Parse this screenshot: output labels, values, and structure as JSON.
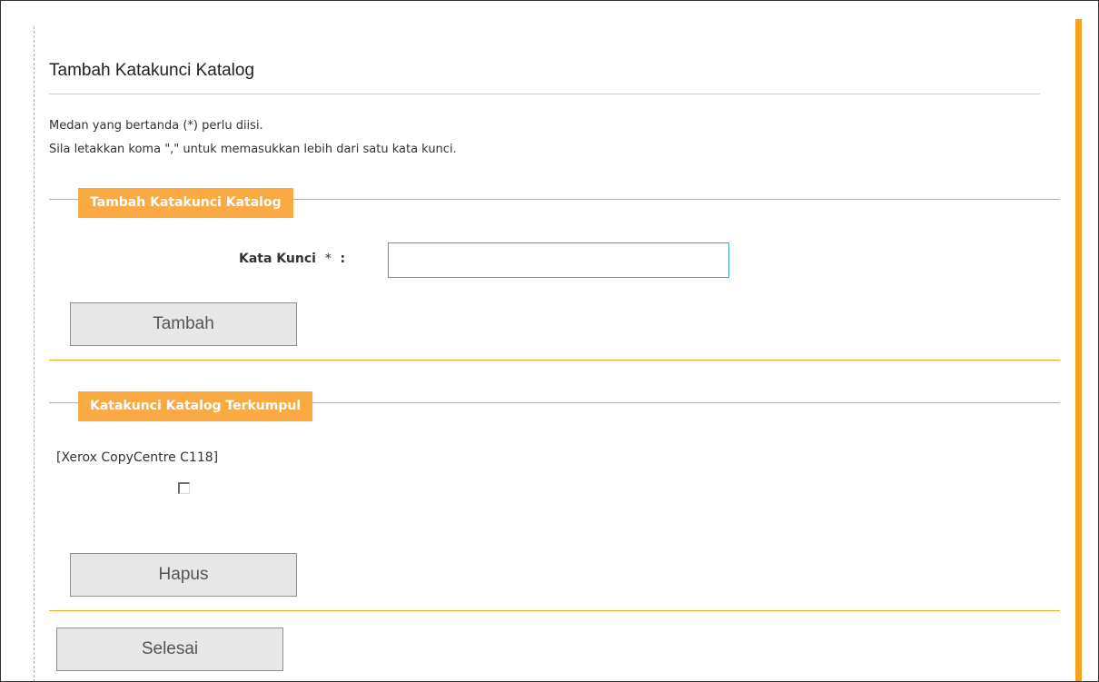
{
  "page": {
    "title": "Tambah Katakunci Katalog",
    "notes": [
      "Medan yang bertanda (*) perlu diisi.",
      "Sila letakkan koma \",\" untuk memasukkan lebih dari satu kata kunci."
    ]
  },
  "add_section": {
    "legend": "Tambah Katakunci Katalog",
    "field_label": "Kata Kunci",
    "required_mark": "*",
    "separator": ":",
    "keyword_value": "",
    "add_button": "Tambah"
  },
  "collected_section": {
    "legend": "Katakunci Katalog Terkumpul",
    "items": [
      {
        "label": "[Xerox CopyCentre C118]",
        "checked": false
      }
    ],
    "delete_button": "Hapus"
  },
  "finish_button": "Selesai",
  "colors": {
    "accent": "#f7a21e",
    "legend_bg": "#fba941",
    "input_border": "#3ba4d8",
    "button_bg": "#e7e7e7"
  }
}
